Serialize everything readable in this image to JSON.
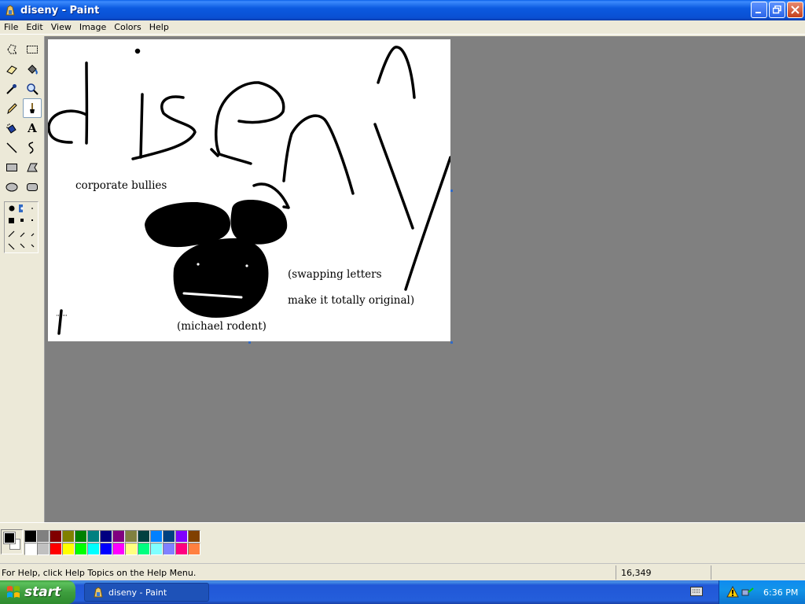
{
  "window": {
    "title": "diseny - Paint",
    "controls": [
      "minimize",
      "restore",
      "close"
    ]
  },
  "menu": [
    "File",
    "Edit",
    "View",
    "Image",
    "Colors",
    "Help"
  ],
  "tools": [
    {
      "icon": "free-form-select-icon"
    },
    {
      "icon": "rect-select-icon"
    },
    {
      "icon": "eraser-icon"
    },
    {
      "icon": "fill-bucket-icon"
    },
    {
      "icon": "color-picker-icon"
    },
    {
      "icon": "magnifier-icon"
    },
    {
      "icon": "pencil-icon"
    },
    {
      "icon": "brush-icon",
      "active": true
    },
    {
      "icon": "airbrush-icon"
    },
    {
      "icon": "text-icon",
      "glyph": "A"
    },
    {
      "icon": "line-icon"
    },
    {
      "icon": "curve-icon"
    },
    {
      "icon": "rectangle-icon"
    },
    {
      "icon": "polygon-icon"
    },
    {
      "icon": "ellipse-icon"
    },
    {
      "icon": "rounded-rect-icon"
    }
  ],
  "canvas_text": {
    "corporate": "corporate bullies",
    "swap1": "(swapping letters",
    "swap2": "make it totally original)",
    "michael": "(michael rodent)"
  },
  "palette": {
    "foreground": "#000000",
    "background": "#ffffff",
    "colors": [
      "#000000",
      "#808080",
      "#800000",
      "#808000",
      "#008000",
      "#008080",
      "#000080",
      "#800080",
      "#808040",
      "#004040",
      "#0080ff",
      "#004080",
      "#8000ff",
      "#804000",
      "#ffffff",
      "#c0c0c0",
      "#ff0000",
      "#ffff00",
      "#00ff00",
      "#00ffff",
      "#0000ff",
      "#ff00ff",
      "#ffff80",
      "#00ff80",
      "#80ffff",
      "#8080ff",
      "#ff0080",
      "#ff8040"
    ]
  },
  "status": {
    "help": "For Help, click Help Topics on the Help Menu.",
    "coords": "16,349"
  },
  "taskbar": {
    "start": "start",
    "task": "diseny - Paint",
    "time": "6:36 PM"
  }
}
